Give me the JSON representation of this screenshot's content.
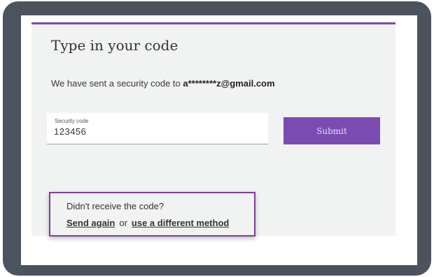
{
  "card": {
    "title": "Type in your code",
    "sent_message_prefix": "We have sent a security code to ",
    "email_masked": "a********z@gmail.com"
  },
  "code_field": {
    "label": "Security code",
    "value": "123456"
  },
  "submit": {
    "label": "Submit"
  },
  "resend": {
    "question": "Didn't receive the code?",
    "send_again": "Send again",
    "or": "or",
    "different_method": "use a different method"
  },
  "colors": {
    "accent": "#7a4bb0",
    "frame": "#4a535e",
    "card_bg": "#f1f2f2",
    "highlight_border": "#7e3f9e"
  }
}
